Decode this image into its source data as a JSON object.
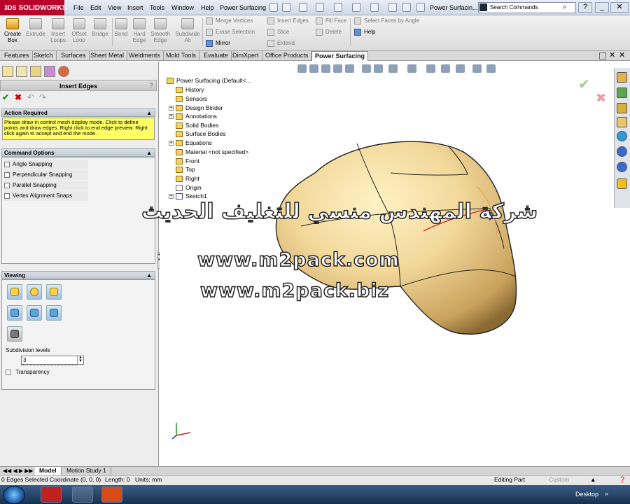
{
  "app": {
    "name": "SOLIDWORKS",
    "title": "Power Surfacin..."
  },
  "menu": [
    "File",
    "Edit",
    "View",
    "Insert",
    "Tools",
    "Window",
    "Help",
    "Power Surfacing"
  ],
  "search": {
    "placeholder": "Search Commands"
  },
  "ribbon": {
    "big": [
      {
        "label": "Create\nBox",
        "active": true
      },
      {
        "label": "Extrude",
        "active": false
      },
      {
        "label": "Insert\nLoops",
        "active": false
      },
      {
        "label": "Offset\nLoop",
        "active": false
      },
      {
        "label": "Bridge",
        "active": false
      },
      {
        "label": "Bend",
        "active": false
      },
      {
        "label": "Hard\nEdge",
        "active": false
      },
      {
        "label": "Smooth\nEdge",
        "active": false
      },
      {
        "label": "Subdivide\nAll",
        "active": false
      }
    ],
    "col1": [
      "Merge Vertices",
      "Erase Selection",
      "Mirror"
    ],
    "col2": [
      "Insert Edges",
      "Slice",
      "Extend"
    ],
    "col3": [
      "Fill Face",
      "Delete"
    ],
    "col4": [
      "Select Faces by Angle",
      "Help"
    ]
  },
  "tabs": [
    "Features",
    "Sketch",
    "Surfaces",
    "Sheet Metal",
    "Weldments",
    "Mold Tools",
    "Evaluate",
    "DimXpert",
    "Office Products",
    "Power Surfacing"
  ],
  "active_tab": "Power Surfacing",
  "panel": {
    "title": "Insert Edges",
    "action_required_title": "Action Required",
    "action_message": "Please draw in control mesh display mode. Click to define points and draw edges. Right click to end edge preview. Right click again to accept and end the mode.",
    "command_options_title": "Command Options",
    "options": [
      "Angle Snapping",
      "Perpendicular Snapping",
      "Parallel Snapping",
      "Vertex Alignment Snaps"
    ],
    "viewing_title": "Viewing",
    "subdivision_label": "Subdivision levels",
    "subdivision_value": "3",
    "transparency_label": "Transparency"
  },
  "tree": [
    {
      "label": "Power Surfacing  (Default<...",
      "expand": false,
      "indent": 0
    },
    {
      "label": "History",
      "expand": false,
      "indent": 1
    },
    {
      "label": "Sensors",
      "expand": false,
      "indent": 1
    },
    {
      "label": "Design Binder",
      "expand": true,
      "indent": 1
    },
    {
      "label": "Annotations",
      "expand": true,
      "indent": 1
    },
    {
      "label": "Solid Bodies",
      "expand": false,
      "indent": 1
    },
    {
      "label": "Surface Bodies",
      "expand": false,
      "indent": 1
    },
    {
      "label": "Equations",
      "expand": true,
      "indent": 1
    },
    {
      "label": "Material <not specified>",
      "expand": false,
      "indent": 1
    },
    {
      "label": "Front",
      "expand": false,
      "indent": 1
    },
    {
      "label": "Top",
      "expand": false,
      "indent": 1
    },
    {
      "label": "Right",
      "expand": false,
      "indent": 1
    },
    {
      "label": "Origin",
      "expand": false,
      "indent": 1
    },
    {
      "label": "Sketch1",
      "expand": true,
      "indent": 1
    }
  ],
  "watermark": {
    "arabic": "شركة المهندس منسي للتغليف الحديث",
    "url1": "www.m2pack.com",
    "url2": "www.m2pack.biz"
  },
  "bottom_tabs": [
    "Model",
    "Motion Study 1"
  ],
  "status": {
    "edges": "0 Edges Selected",
    "coordinate": "Coordinate (0, 0, 0)",
    "length": "Length: 0",
    "units": "Units: mm",
    "mode": "Editing Part",
    "custom": "Custom"
  },
  "taskbar": {
    "desktop": "Desktop"
  },
  "colors": {
    "brand": "#b8002a",
    "model": "#f2d89a",
    "message_bg": "#ffff66"
  }
}
